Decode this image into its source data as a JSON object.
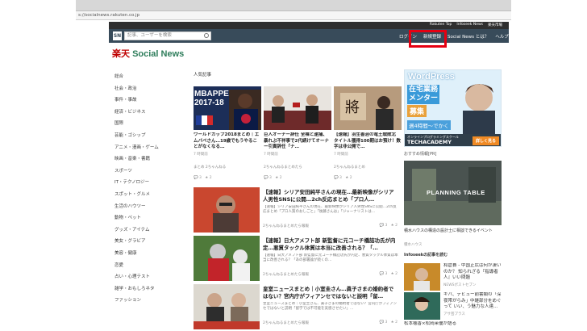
{
  "browser": {
    "url": "s://socialnews.rakuten.co.jp"
  },
  "topstrip": {
    "links": [
      "Rakuten Top",
      "Infoseek News",
      "楽天市場"
    ]
  },
  "navbar": {
    "logo": "SN",
    "search_placeholder": "記事、ユーザーを検索",
    "login": "ログイン",
    "register": "新規登録",
    "about": "Social News とは？",
    "help": "ヘルプ"
  },
  "brand": {
    "rakuten": "楽天",
    "name": "Social News"
  },
  "sidebar": [
    "総合",
    "社会・政治",
    "事件・事故",
    "経済・ビジネス",
    "国際",
    "芸能・ゴシップ",
    "アニメ・漫画・ゲーム",
    "映画・音楽・書籍",
    "スポーツ",
    "IT・テクノロジー",
    "スポット・グルメ",
    "生活のハウツー",
    "動物・ペット",
    "グッズ・アイテム",
    "美女・グラビア",
    "美容・健康",
    "恋愛",
    "占い・心理テスト",
    "雑学・おもしろネタ",
    "ファッション"
  ],
  "section_label": "人気記事",
  "cards": [
    {
      "thumb_text": "MBAPPE 2017-18",
      "title": "ワールドカップ2018まとめ｜エムバペさん…19歳でもうやることがなくなる…",
      "meta": "7 時間前",
      "source": "まとめ 2ちゃんねる",
      "comments": "3",
      "likes": "2"
    },
    {
      "thumb_text": "",
      "title": "巨人オーナー辞任 全裸と逮捕、暴れぶ不祥事で2代続けてオーナー引責辞任「ナ…",
      "meta": "7 時間前",
      "source": "2ちゃんねるまとめたら",
      "comments": "3",
      "likes": "2"
    },
    {
      "thumb_text": "",
      "title": "【速報】羽生善治の竜王戦敗北 タイトル獲得100期はお預け！数字は非公開で…",
      "meta": "7 時間前",
      "source": "2ちゃんねるまとめ",
      "comments": "3",
      "likes": "2"
    }
  ],
  "wide_articles": [
    {
      "title": "【速報】シリア安田純平さんの現在…最新映像がシリア人男性SNSに公開…2ch反応まとめ「プロ人…",
      "desc": "【速報】シリア安田純平さんの現在、最新映像がシリア人男性SNSに公開…2ch反応まとめ「プロ人質のおしごと」「後藤さんは」「ジャーナリストは…",
      "source": "2ちゃんねるまとめたら報報",
      "comments": "3",
      "likes": "2"
    },
    {
      "title": "【速報】日大アメフト部 新監督に元コーチ橋詰功氏が内定…悪質タックル体質は本当に改善される？「…",
      "desc": "【速報】日大アメフト部 新監督に元コーチ橋詰功氏が内定、悪質タックル体質は本当に改善される？「あの部署論が続くの…",
      "source": "2ちゃんねるまとめたら報報",
      "comments": "3",
      "likes": "2"
    },
    {
      "title": "皇室ニュースまとめ｜小室圭さん…眞子さまの婚約者ではない？宮内庁がフィアンセではないと説明「留…",
      "desc": "皇室ニュースまとめ｜小室圭さん、眞子さまの婚約者ではない？宮内庁がフィアンセではないと説明「留学では不可能を実感させたい」…",
      "source": "2ちゃんねるまとめたら報報",
      "comments": "3",
      "likes": "2"
    }
  ],
  "ad": {
    "title": "WordPress",
    "sub1": "在宅業務",
    "sub2": "メンター",
    "pill": "募集",
    "small": "週4時間〜でかく",
    "bottom1": "オンラインプログラミングスクール",
    "bottom2": "TECHACADEMY",
    "button": "詳しく見る"
  },
  "side_label": "おすすめ情報[PR]",
  "planning": {
    "image_text": "PLANNING TABLE",
    "caption": "積水ハウスの構造の設計士に相談できるイベント",
    "source": "積水ハウス"
  },
  "infoseek_label": "Infoseekの記事を読む",
  "side_items": [
    {
      "text": "和倉賽 - 中国正広は何が凄いのか？ 知られざる『指導者人』いい問題",
      "source": "NEWSポストセブン"
    },
    {
      "text": "ギバ、デビュー前書類の「深夜帯がらみ」中継部分をめぐって いい、う魅力な人達…",
      "source": "アサ芸プラス"
    },
    {
      "text": "松本穂香×松岡茉優が語る",
      "source": ""
    }
  ],
  "colors": {
    "navbar": "#384b5a",
    "brand": "#2e7d5b",
    "highlight": "#e60012"
  }
}
